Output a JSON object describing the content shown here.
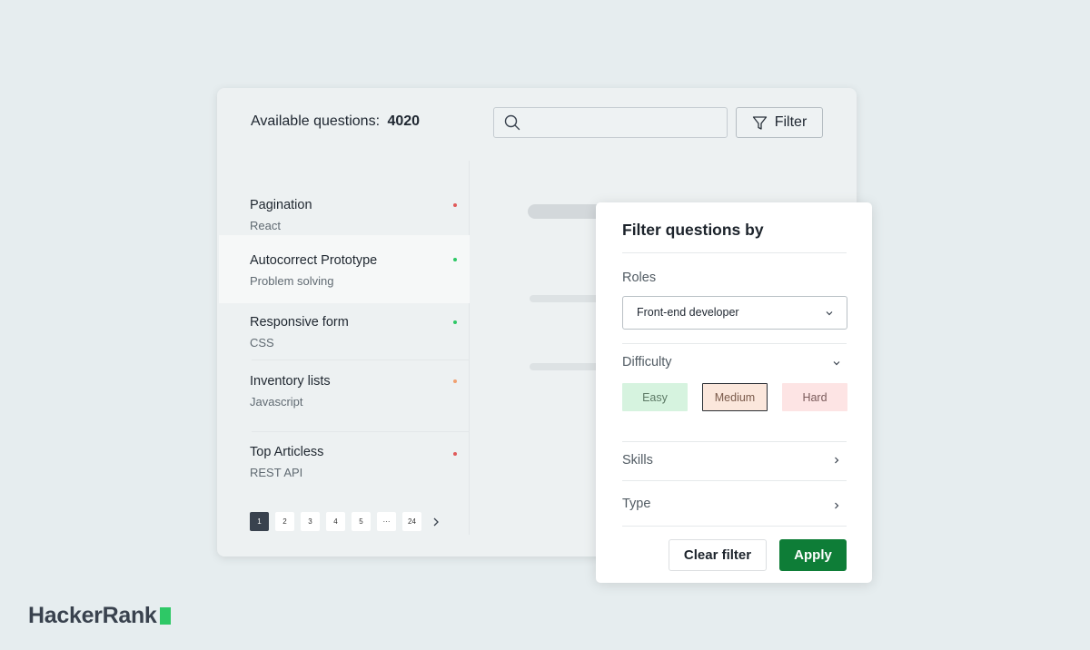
{
  "header": {
    "available_label": "Available questions:",
    "available_count": "4020",
    "search_placeholder": "",
    "filter_label": "Filter"
  },
  "questions": [
    {
      "title": "Pagination",
      "subtitle": "React",
      "status_color": "#e05a5a"
    },
    {
      "title": "Autocorrect Prototype",
      "subtitle": "Problem solving",
      "status_color": "#2ec866"
    },
    {
      "title": "Responsive form",
      "subtitle": "CSS",
      "status_color": "#2ec866"
    },
    {
      "title": "Inventory lists",
      "subtitle": "Javascript",
      "status_color": "#f0a070"
    },
    {
      "title": "Top Articless",
      "subtitle": "REST API",
      "status_color": "#e05a5a"
    }
  ],
  "pagination": {
    "pages": [
      "1",
      "2",
      "3",
      "4",
      "5",
      "···",
      "24"
    ],
    "current": "1"
  },
  "filter_popup": {
    "title": "Filter questions by",
    "roles_label": "Roles",
    "role_selected": "Front-end developer",
    "difficulty_label": "Difficulty",
    "difficulty_options": [
      {
        "label": "Easy",
        "bg": "#d6f3df",
        "color": "#5d7a66",
        "border": "none"
      },
      {
        "label": "Medium",
        "bg": "#fbe7dc",
        "color": "#7a5a4a",
        "border": "#2a2f35"
      },
      {
        "label": "Hard",
        "bg": "#fde4e4",
        "color": "#7a5a5a",
        "border": "none"
      }
    ],
    "skills_label": "Skills",
    "type_label": "Type",
    "clear_label": "Clear filter",
    "apply_label": "Apply"
  },
  "brand": {
    "logo_text": "HackerRank",
    "accent": "#2ec866",
    "primary_button": "#0e7d37"
  }
}
